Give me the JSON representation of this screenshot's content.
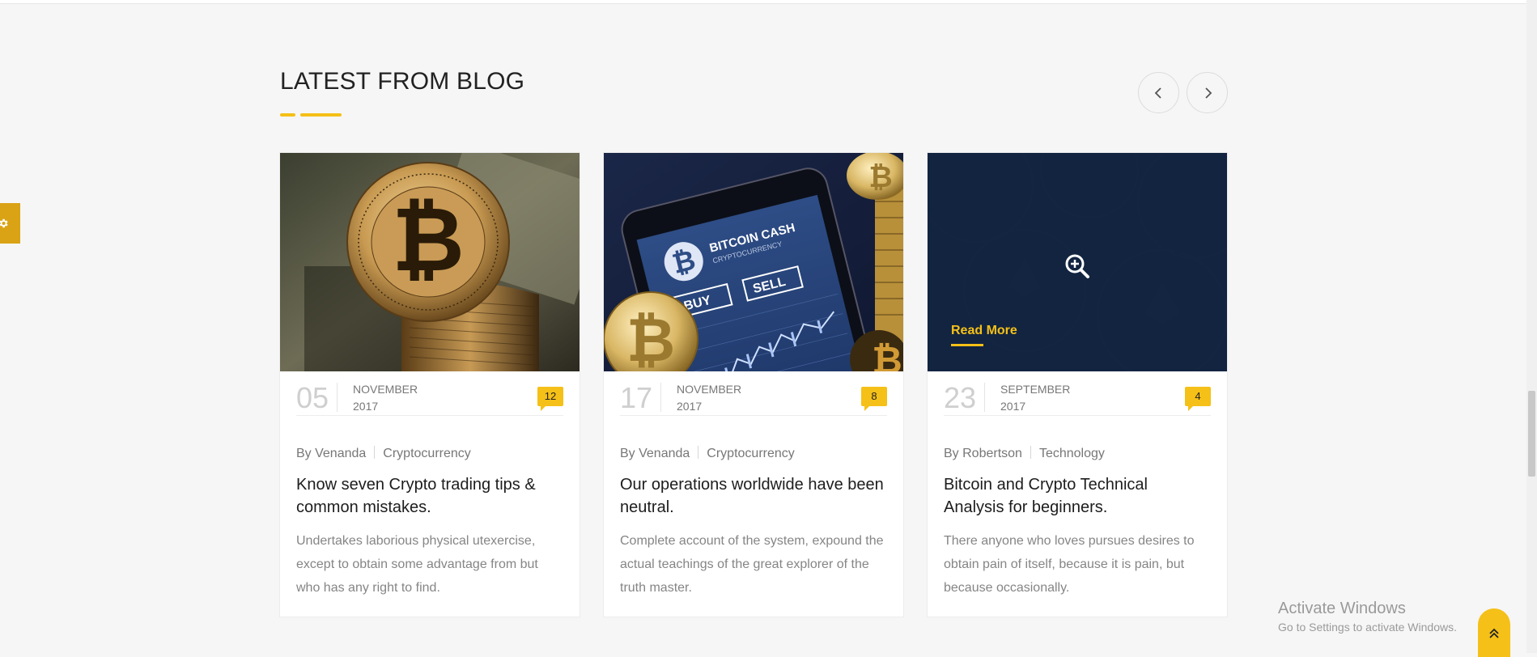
{
  "section": {
    "title": "LATEST FROM BLOG"
  },
  "nav": {
    "prev_icon": "chevron-left-icon",
    "next_icon": "chevron-right-icon"
  },
  "posts": [
    {
      "day": "05",
      "month": "NOVEMBER",
      "year": "2017",
      "comments": "12",
      "author": "By Venanda",
      "category": "Cryptocurrency",
      "title": "Know seven Crypto trading tips & common mistakes.",
      "excerpt": "Undertakes laborious physical utexercise, except to obtain some advantage from but who has any right to find.",
      "image": "bitcoin-coin-stack-on-dollar"
    },
    {
      "day": "17",
      "month": "NOVEMBER",
      "year": "2017",
      "comments": "8",
      "author": "By Venanda",
      "category": "Cryptocurrency",
      "title": "Our operations worldwide have been neutral.",
      "excerpt": "Complete account of the system, expound the actual teachings of the great explorer of the truth master.",
      "image": "bitcoin-cash-phone-app",
      "phone_screen": {
        "brand": "BITCOIN CASH",
        "sub": "CRYPTOCURRENCY",
        "buy": "BUY",
        "sell": "SELL"
      }
    },
    {
      "day": "23",
      "month": "SEPTEMBER",
      "year": "2017",
      "comments": "4",
      "author": "By Robertson",
      "category": "Technology",
      "title": "Bitcoin and Crypto Technical Analysis for beginners.",
      "excerpt": "There anyone who loves pursues desires to obtain pain of itself, because it is pain, but because occasionally.",
      "image": "ethereum-coins-dark-overlay",
      "hover_label": "Read More"
    }
  ],
  "windows_watermark": {
    "line1": "Activate Windows",
    "line2": "Go to Settings to activate Windows."
  },
  "colors": {
    "accent": "#f5c017",
    "settings_tab": "#d9a315",
    "overlay": "#122440",
    "background": "#f6f6f6"
  }
}
